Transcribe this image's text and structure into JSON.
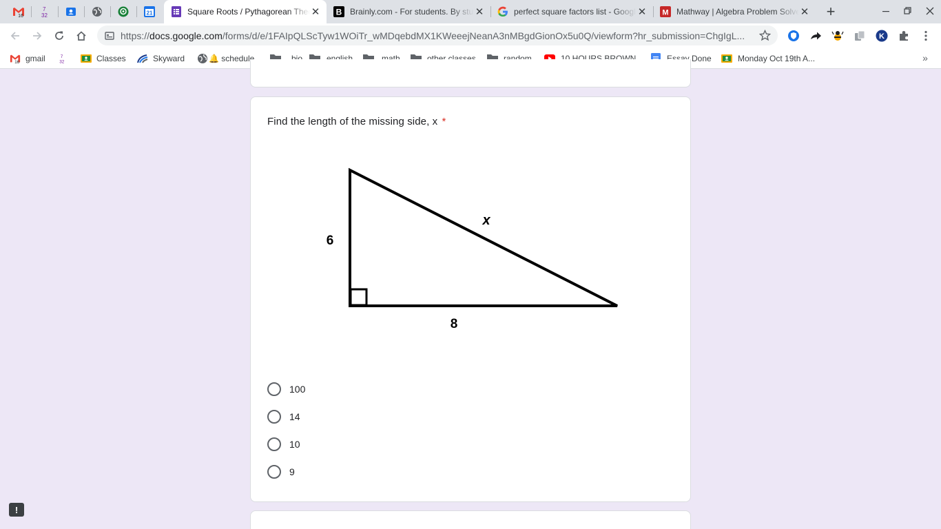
{
  "pinned_tabs": [
    {
      "name": "gmail-tab",
      "icon": "gmail-icon",
      "badge": "16"
    },
    {
      "name": "fraction-tab",
      "icon": "fraction-icon",
      "num": "7",
      "den": "32"
    },
    {
      "name": "classroom-tab",
      "icon": "person-badge-icon"
    },
    {
      "name": "globe-tab",
      "icon": "globe-icon"
    },
    {
      "name": "location-tab",
      "icon": "location-icon"
    },
    {
      "name": "calendar-tab",
      "icon": "calendar-icon",
      "label": "21"
    }
  ],
  "tabs": [
    {
      "title": "Square Roots / Pythagorean Theorem",
      "icon": "google-forms-icon",
      "active": true
    },
    {
      "title": "Brainly.com - For students. By students.",
      "icon": "brainly-icon",
      "active": false
    },
    {
      "title": "perfect square factors list - Google Search",
      "icon": "google-icon",
      "active": false
    },
    {
      "title": "Mathway | Algebra Problem Solver",
      "icon": "mathway-icon",
      "active": false
    }
  ],
  "toolbar": {
    "url_host": "docs.google.com",
    "url_prefix": "https://",
    "url_path": "/forms/d/e/1FAIpQLScTyw1WOiTr_wMDqebdMX1KWeeejNeanA3nMBgdGionOx5u0Q/viewform?hr_submission=ChgIgL..."
  },
  "bookmarks": [
    {
      "label": "gmail",
      "icon": "gmail-icon",
      "badge": "16"
    },
    {
      "label": "",
      "icon": "fraction-icon",
      "num": "7",
      "den": "32"
    },
    {
      "label": "Classes",
      "icon": "classroom-icon"
    },
    {
      "label": "Skyward",
      "icon": "skyward-icon"
    },
    {
      "label": "🔔 schedule",
      "icon": "globe-icon"
    },
    {
      "label": "bio",
      "icon": "folder-icon"
    },
    {
      "label": "english",
      "icon": "folder-icon"
    },
    {
      "label": "math",
      "icon": "folder-icon"
    },
    {
      "label": "other classes",
      "icon": "folder-icon"
    },
    {
      "label": "random",
      "icon": "folder-icon"
    },
    {
      "label": "10 HOURS BROWN...",
      "icon": "youtube-icon"
    },
    {
      "label": "Essay Done",
      "icon": "docs-icon"
    },
    {
      "label": "Monday Oct 19th A...",
      "icon": "classroom-icon"
    }
  ],
  "question": {
    "title": "Find the length of the missing side, x",
    "required_marker": "*",
    "figure": {
      "side_vertical": "6",
      "side_horizontal": "8",
      "hypotenuse": "x"
    },
    "options": [
      "100",
      "14",
      "10",
      "9"
    ]
  },
  "colors": {
    "page_bg": "#ede7f6",
    "required": "#d93025",
    "forms_purple": "#673ab7"
  }
}
